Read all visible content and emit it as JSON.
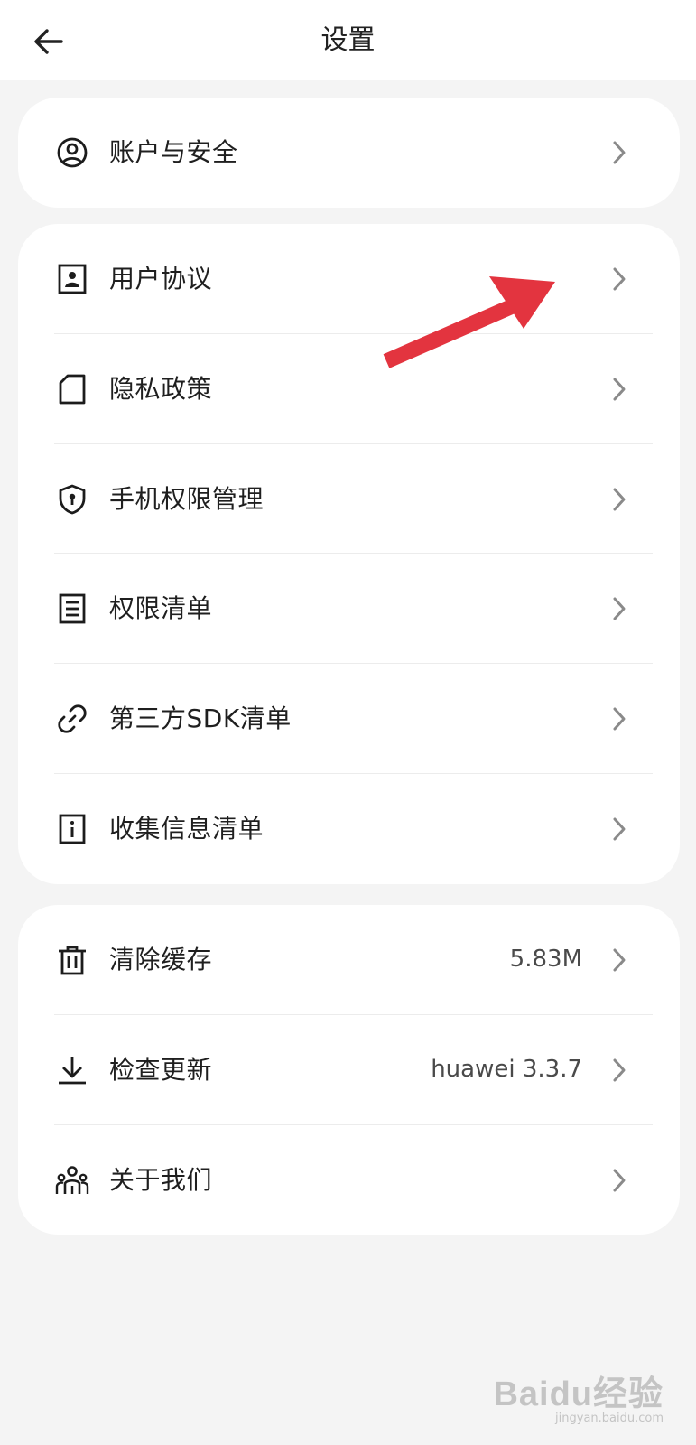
{
  "header": {
    "title": "设置",
    "back_icon": "arrow-left-icon"
  },
  "cards": [
    {
      "items": [
        {
          "label": "账户与安全",
          "icon": "user-circle-icon"
        }
      ]
    },
    {
      "items": [
        {
          "label": "用户协议",
          "icon": "user-document-icon"
        },
        {
          "label": "隐私政策",
          "icon": "file-icon"
        },
        {
          "label": "手机权限管理",
          "icon": "shield-lock-icon"
        },
        {
          "label": "权限清单",
          "icon": "list-document-icon"
        },
        {
          "label": "第三方SDK清单",
          "icon": "link-icon"
        },
        {
          "label": "收集信息清单",
          "icon": "info-document-icon"
        }
      ]
    },
    {
      "items": [
        {
          "label": "清除缓存",
          "icon": "trash-icon",
          "value": "5.83M"
        },
        {
          "label": "检查更新",
          "icon": "download-icon",
          "value": "huawei 3.3.7"
        },
        {
          "label": "关于我们",
          "icon": "group-icon"
        }
      ]
    }
  ],
  "annotation": {
    "color": "#e3343f",
    "icon": "red-arrow-annotation"
  },
  "watermark": {
    "logo": "Baidu经验",
    "sub": "jingyan.baidu.com"
  }
}
